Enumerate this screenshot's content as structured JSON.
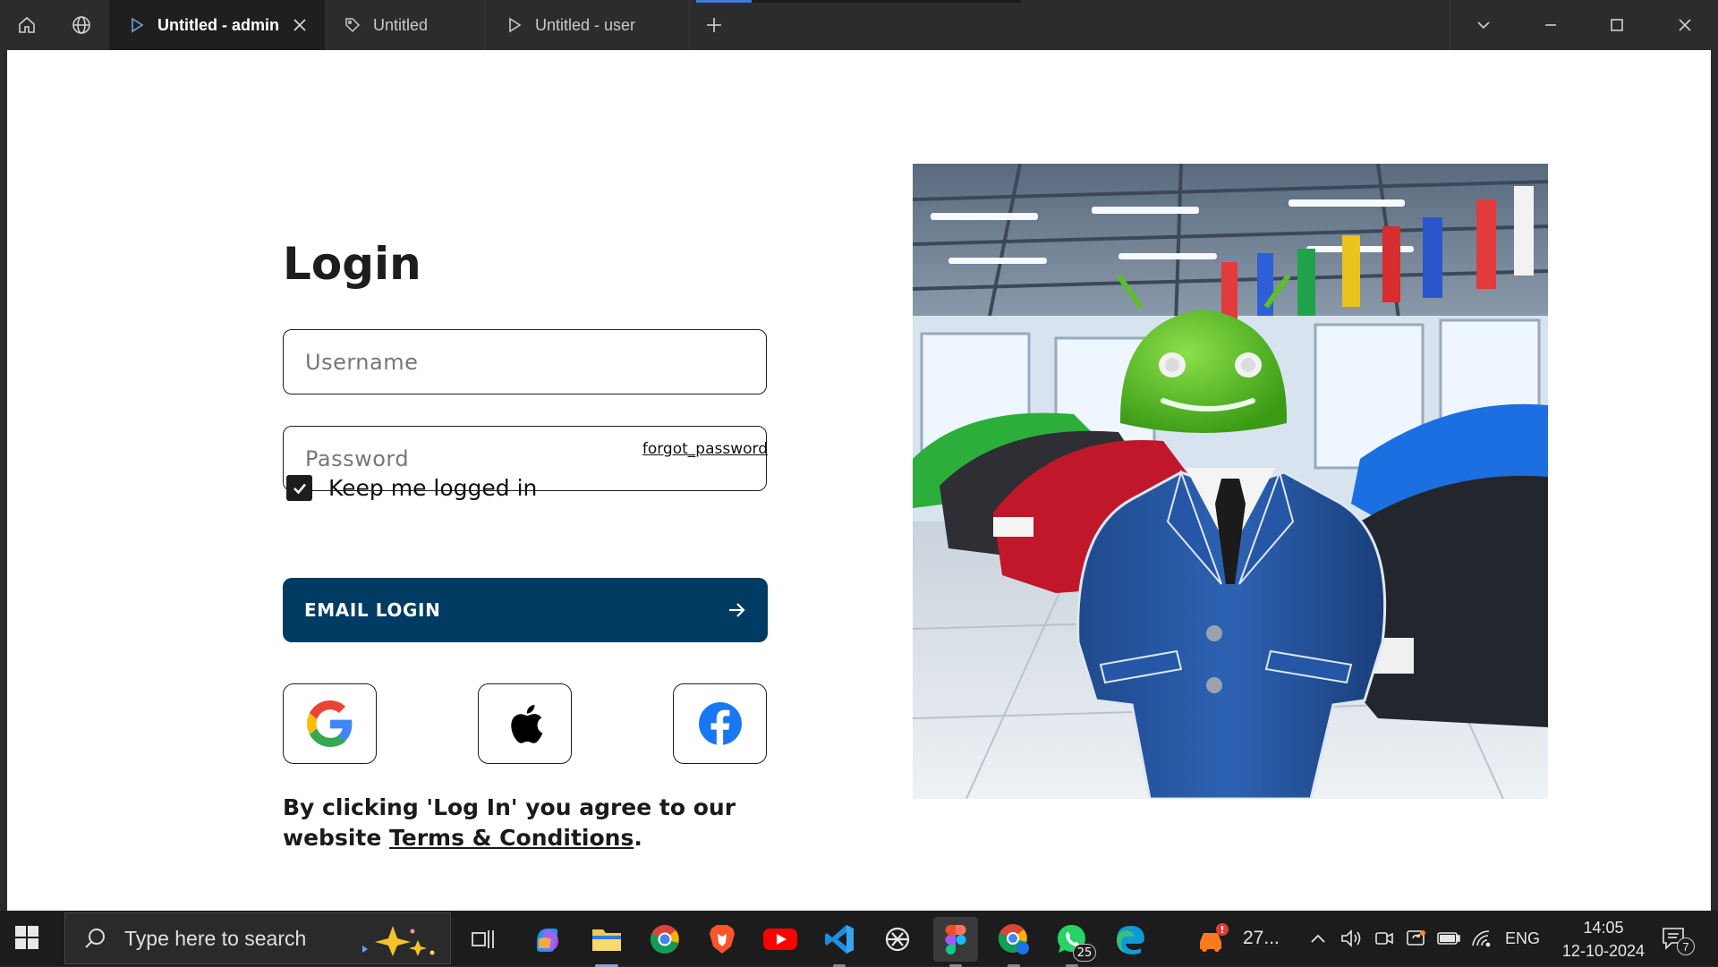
{
  "window": {
    "tabs": [
      {
        "label": "Untitled - admin",
        "icon": "play-icon",
        "active": true
      },
      {
        "label": "Untitled",
        "icon": "tag-icon",
        "active": false
      },
      {
        "label": "Untitled - user",
        "icon": "play-icon",
        "active": false
      }
    ],
    "loading_progress": 0.17
  },
  "login": {
    "title": "Login",
    "username_placeholder": "Username",
    "password_placeholder": "Password",
    "forgot_label": "forgot_password",
    "keep_label": "Keep me logged in",
    "keep_checked": true,
    "email_button": "EMAIL LOGIN",
    "social": [
      "google-icon",
      "apple-icon",
      "facebook-icon"
    ],
    "terms_text": "By clicking 'Log In' you agree to our website ",
    "terms_link": "Terms & Conditions",
    "terms_end": ".",
    "brand_color": "#003b63"
  },
  "taskbar": {
    "search_placeholder": "Type here to search",
    "weather_label": "27...",
    "whatsapp_badge": "25",
    "language": "ENG",
    "time": "14:05",
    "date": "12-10-2024",
    "notifications": "7"
  }
}
